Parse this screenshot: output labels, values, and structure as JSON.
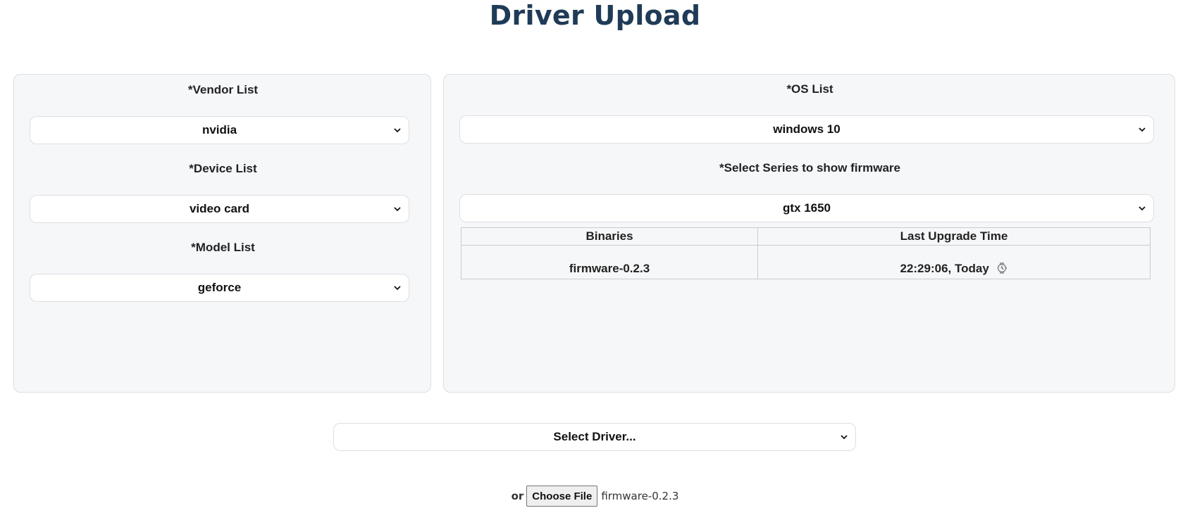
{
  "page": {
    "title": "Driver Upload"
  },
  "left_panel": {
    "vendor_label": "*Vendor List",
    "vendor_value": "nvidia",
    "device_label": "*Device List",
    "device_value": "video card",
    "model_label": "*Model List",
    "model_value": "geforce"
  },
  "right_panel": {
    "os_label": "*OS List",
    "os_value": "windows 10",
    "series_label": "*Select Series to show firmware",
    "series_value": "gtx 1650",
    "table": {
      "headers": [
        "Binaries",
        "Last Upgrade Time"
      ],
      "rows": [
        {
          "binary": "firmware-0.2.3",
          "upgrade_time": "22:29:06, Today"
        }
      ]
    }
  },
  "driver_select": {
    "value": "Select Driver..."
  },
  "file_upload": {
    "or_label": "or",
    "button_label": "Choose File",
    "file_name": "firmware-0.2.3"
  },
  "icons": {
    "select_chevron": "chevron-down-icon",
    "time_icon": "watch-icon"
  }
}
